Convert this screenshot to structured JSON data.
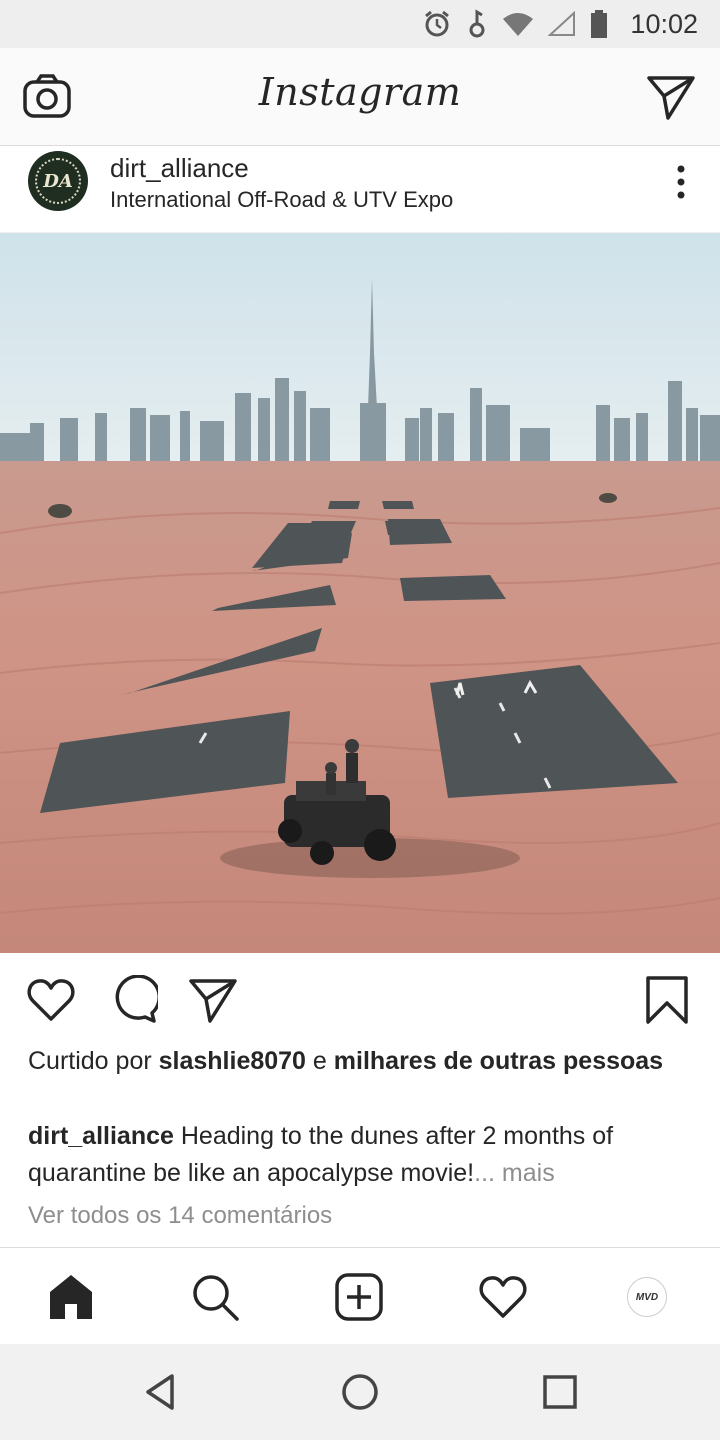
{
  "status_bar": {
    "time": "10:02",
    "icons": [
      "alarm-icon",
      "headphones-icon",
      "wifi-icon",
      "signal-icon",
      "battery-icon"
    ]
  },
  "header": {
    "app_title": "Instagram",
    "left_icon": "camera-icon",
    "right_icon": "direct-message-icon"
  },
  "post": {
    "username": "dirt_alliance",
    "location": "International Off-Road & UTV Expo",
    "avatar_text": "DA",
    "image_alt": "photo",
    "actions": [
      "heart-icon",
      "comment-icon",
      "share-icon",
      "bookmark-icon"
    ],
    "likes": {
      "prefix": "Curtido por",
      "user": "slashlie8070",
      "joiner": "e",
      "others": "milhares de outras pessoas"
    },
    "caption": {
      "username": "dirt_alliance",
      "text": "Heading to the dunes after 2 months of quarantine be like an apocalypse movie!",
      "ellipsis": "...",
      "more": "mais"
    },
    "comments_link": "Ver todos os 14 comentários"
  },
  "bottom_nav": {
    "items": [
      "home-icon",
      "search-icon",
      "add-post-icon",
      "activity-icon",
      "profile-avatar"
    ],
    "profile_avatar_text": "MVD"
  },
  "system_nav": {
    "items": [
      "back-icon",
      "home-circle-icon",
      "recents-icon"
    ]
  },
  "colors": {
    "text": "#262626",
    "secondary": "#8e8e8e",
    "border": "#dbdbdb",
    "sand": "#c98f80",
    "sky": "#cfe0e6"
  }
}
